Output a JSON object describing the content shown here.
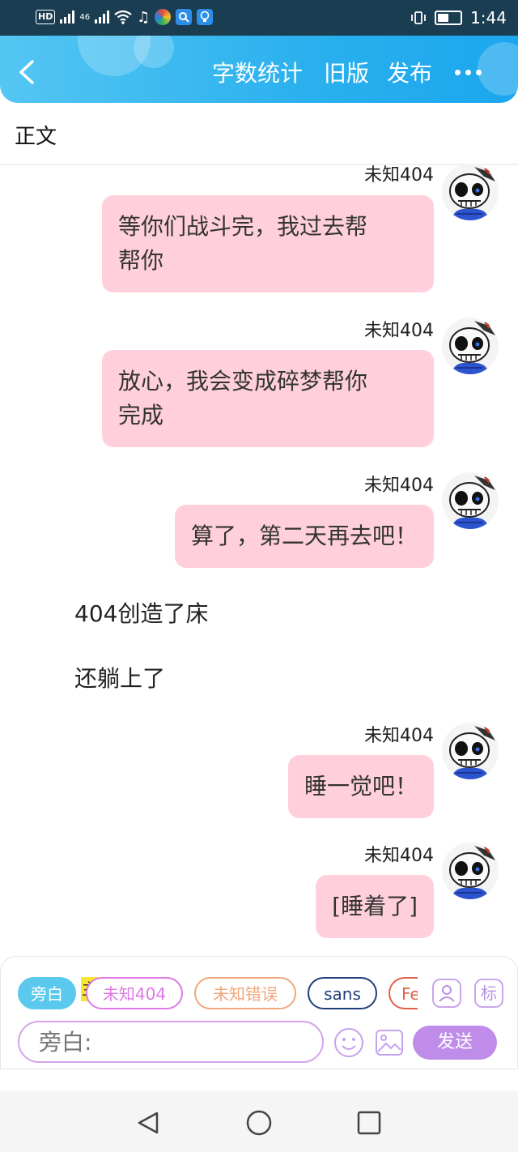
{
  "status_bar": {
    "hd_label": "HD",
    "network_label": "46",
    "time": "1:44",
    "battery_level": 0.55
  },
  "header": {
    "actions": [
      "字数统计",
      "旧版",
      "发布"
    ],
    "back_icon": "chevron-left-icon",
    "more_icon": "more-dots-icon"
  },
  "section": {
    "title": "正文"
  },
  "messages": [
    {
      "type": "bubble",
      "name": "未知404",
      "lines": [
        "等你们战斗完，我过去帮",
        "帮你"
      ]
    },
    {
      "type": "bubble",
      "name": "未知404",
      "lines": [
        "放心，我会变成碎梦帮你",
        "完成"
      ]
    },
    {
      "type": "bubble",
      "name": "未知404",
      "lines": [
        "算了，第二天再去吧！"
      ]
    },
    {
      "type": "narration",
      "text": "404创造了床"
    },
    {
      "type": "narration",
      "text": "还躺上了"
    },
    {
      "type": "bubble",
      "name": "未知404",
      "lines": [
        "睡一觉吧！"
      ]
    },
    {
      "type": "bubble",
      "name": "未知404",
      "lines": [
        "[睡着了]"
      ]
    }
  ],
  "composer": {
    "chips": [
      {
        "label": "旁白",
        "selected": true,
        "color": "#5bc8ee"
      },
      {
        "label": "未知404",
        "selected": false,
        "color": "#de79e6",
        "main_tag": "主"
      },
      {
        "label": "未知错误",
        "selected": false,
        "color": "#f0a77b"
      },
      {
        "label": "sans",
        "selected": false,
        "color": "#1f3f7a"
      },
      {
        "label": "Fe",
        "selected": false,
        "color": "#e0604c"
      }
    ],
    "side_buttons": [
      {
        "icon": "user-card-icon"
      },
      {
        "label": "标"
      }
    ],
    "input_placeholder": "旁白:",
    "emoji_icon": "smiley-icon",
    "image_icon": "image-icon",
    "send_label": "发送"
  },
  "nav": {
    "back": "triangle-back-icon",
    "home": "circle-home-icon",
    "recents": "square-recents-icon"
  }
}
